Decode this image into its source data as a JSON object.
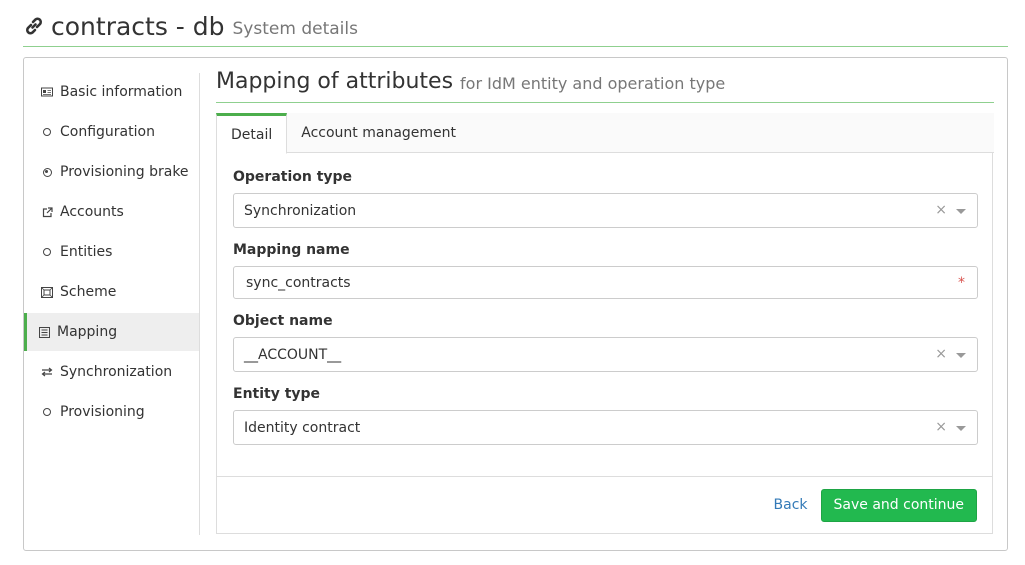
{
  "header": {
    "title": "contracts - db",
    "subtitle": "System details",
    "icon": "link-icon"
  },
  "sidebar": {
    "items": [
      {
        "label": "Basic information",
        "icon": "card-icon"
      },
      {
        "label": "Configuration",
        "icon": "circle-icon"
      },
      {
        "label": "Provisioning brake",
        "icon": "dot-circle-icon"
      },
      {
        "label": "Accounts",
        "icon": "external-link-icon"
      },
      {
        "label": "Entities",
        "icon": "circle-icon"
      },
      {
        "label": "Scheme",
        "icon": "scheme-icon"
      },
      {
        "label": "Mapping",
        "icon": "list-icon",
        "active": true
      },
      {
        "label": "Synchronization",
        "icon": "exchange-icon"
      },
      {
        "label": "Provisioning",
        "icon": "circle-icon"
      }
    ]
  },
  "main": {
    "title": "Mapping of attributes",
    "subtitle": "for IdM entity and operation type",
    "tabs": [
      {
        "label": "Detail",
        "active": true
      },
      {
        "label": "Account management"
      }
    ],
    "form": {
      "operation_type": {
        "label": "Operation type",
        "value": "Synchronization"
      },
      "mapping_name": {
        "label": "Mapping name",
        "value": "sync_contracts",
        "required_mark": "*"
      },
      "object_name": {
        "label": "Object name",
        "value": "__ACCOUNT__"
      },
      "entity_type": {
        "label": "Entity type",
        "value": "Identity contract"
      }
    },
    "footer": {
      "back_label": "Back",
      "save_label": "Save and continue"
    }
  },
  "colors": {
    "accent": "#4cae4c",
    "primary_button": "#22b94f",
    "link": "#337ab7",
    "required": "#d9534f"
  }
}
